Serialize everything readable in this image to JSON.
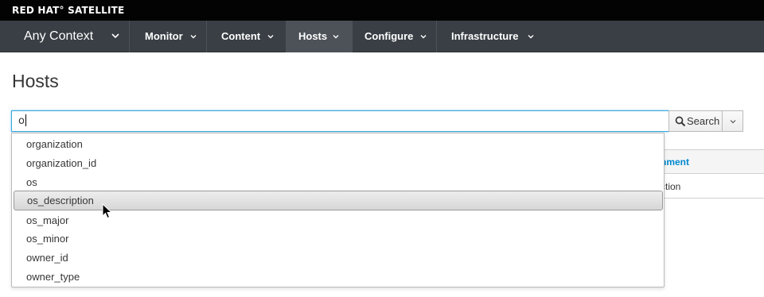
{
  "brand": {
    "text": "RED HAT° SATELLITE"
  },
  "nav": {
    "context_label": "Any Context",
    "items": [
      {
        "label": "Monitor",
        "active": false
      },
      {
        "label": "Content",
        "active": false
      },
      {
        "label": "Hosts",
        "active": true
      },
      {
        "label": "Configure",
        "active": false
      },
      {
        "label": "Infrastructure",
        "active": false
      }
    ]
  },
  "page": {
    "title": "Hosts"
  },
  "search": {
    "value": "o",
    "button_label": "Search",
    "icons": {
      "button": "search-icon",
      "dropdown": "caret-down-icon"
    }
  },
  "table": {
    "partial_header": "nment",
    "partial_cell": "ction"
  },
  "autocomplete": {
    "items": [
      "organization",
      "organization_id",
      "os",
      "os_description",
      "os_major",
      "os_minor",
      "owner_id",
      "owner_type"
    ],
    "highlighted": "os_description"
  },
  "colors": {
    "brandbar": "#030303",
    "navbar": "#393f44",
    "nav_active": "#4d5258",
    "focus_border": "#39a5dc",
    "link": "#0088ce"
  }
}
